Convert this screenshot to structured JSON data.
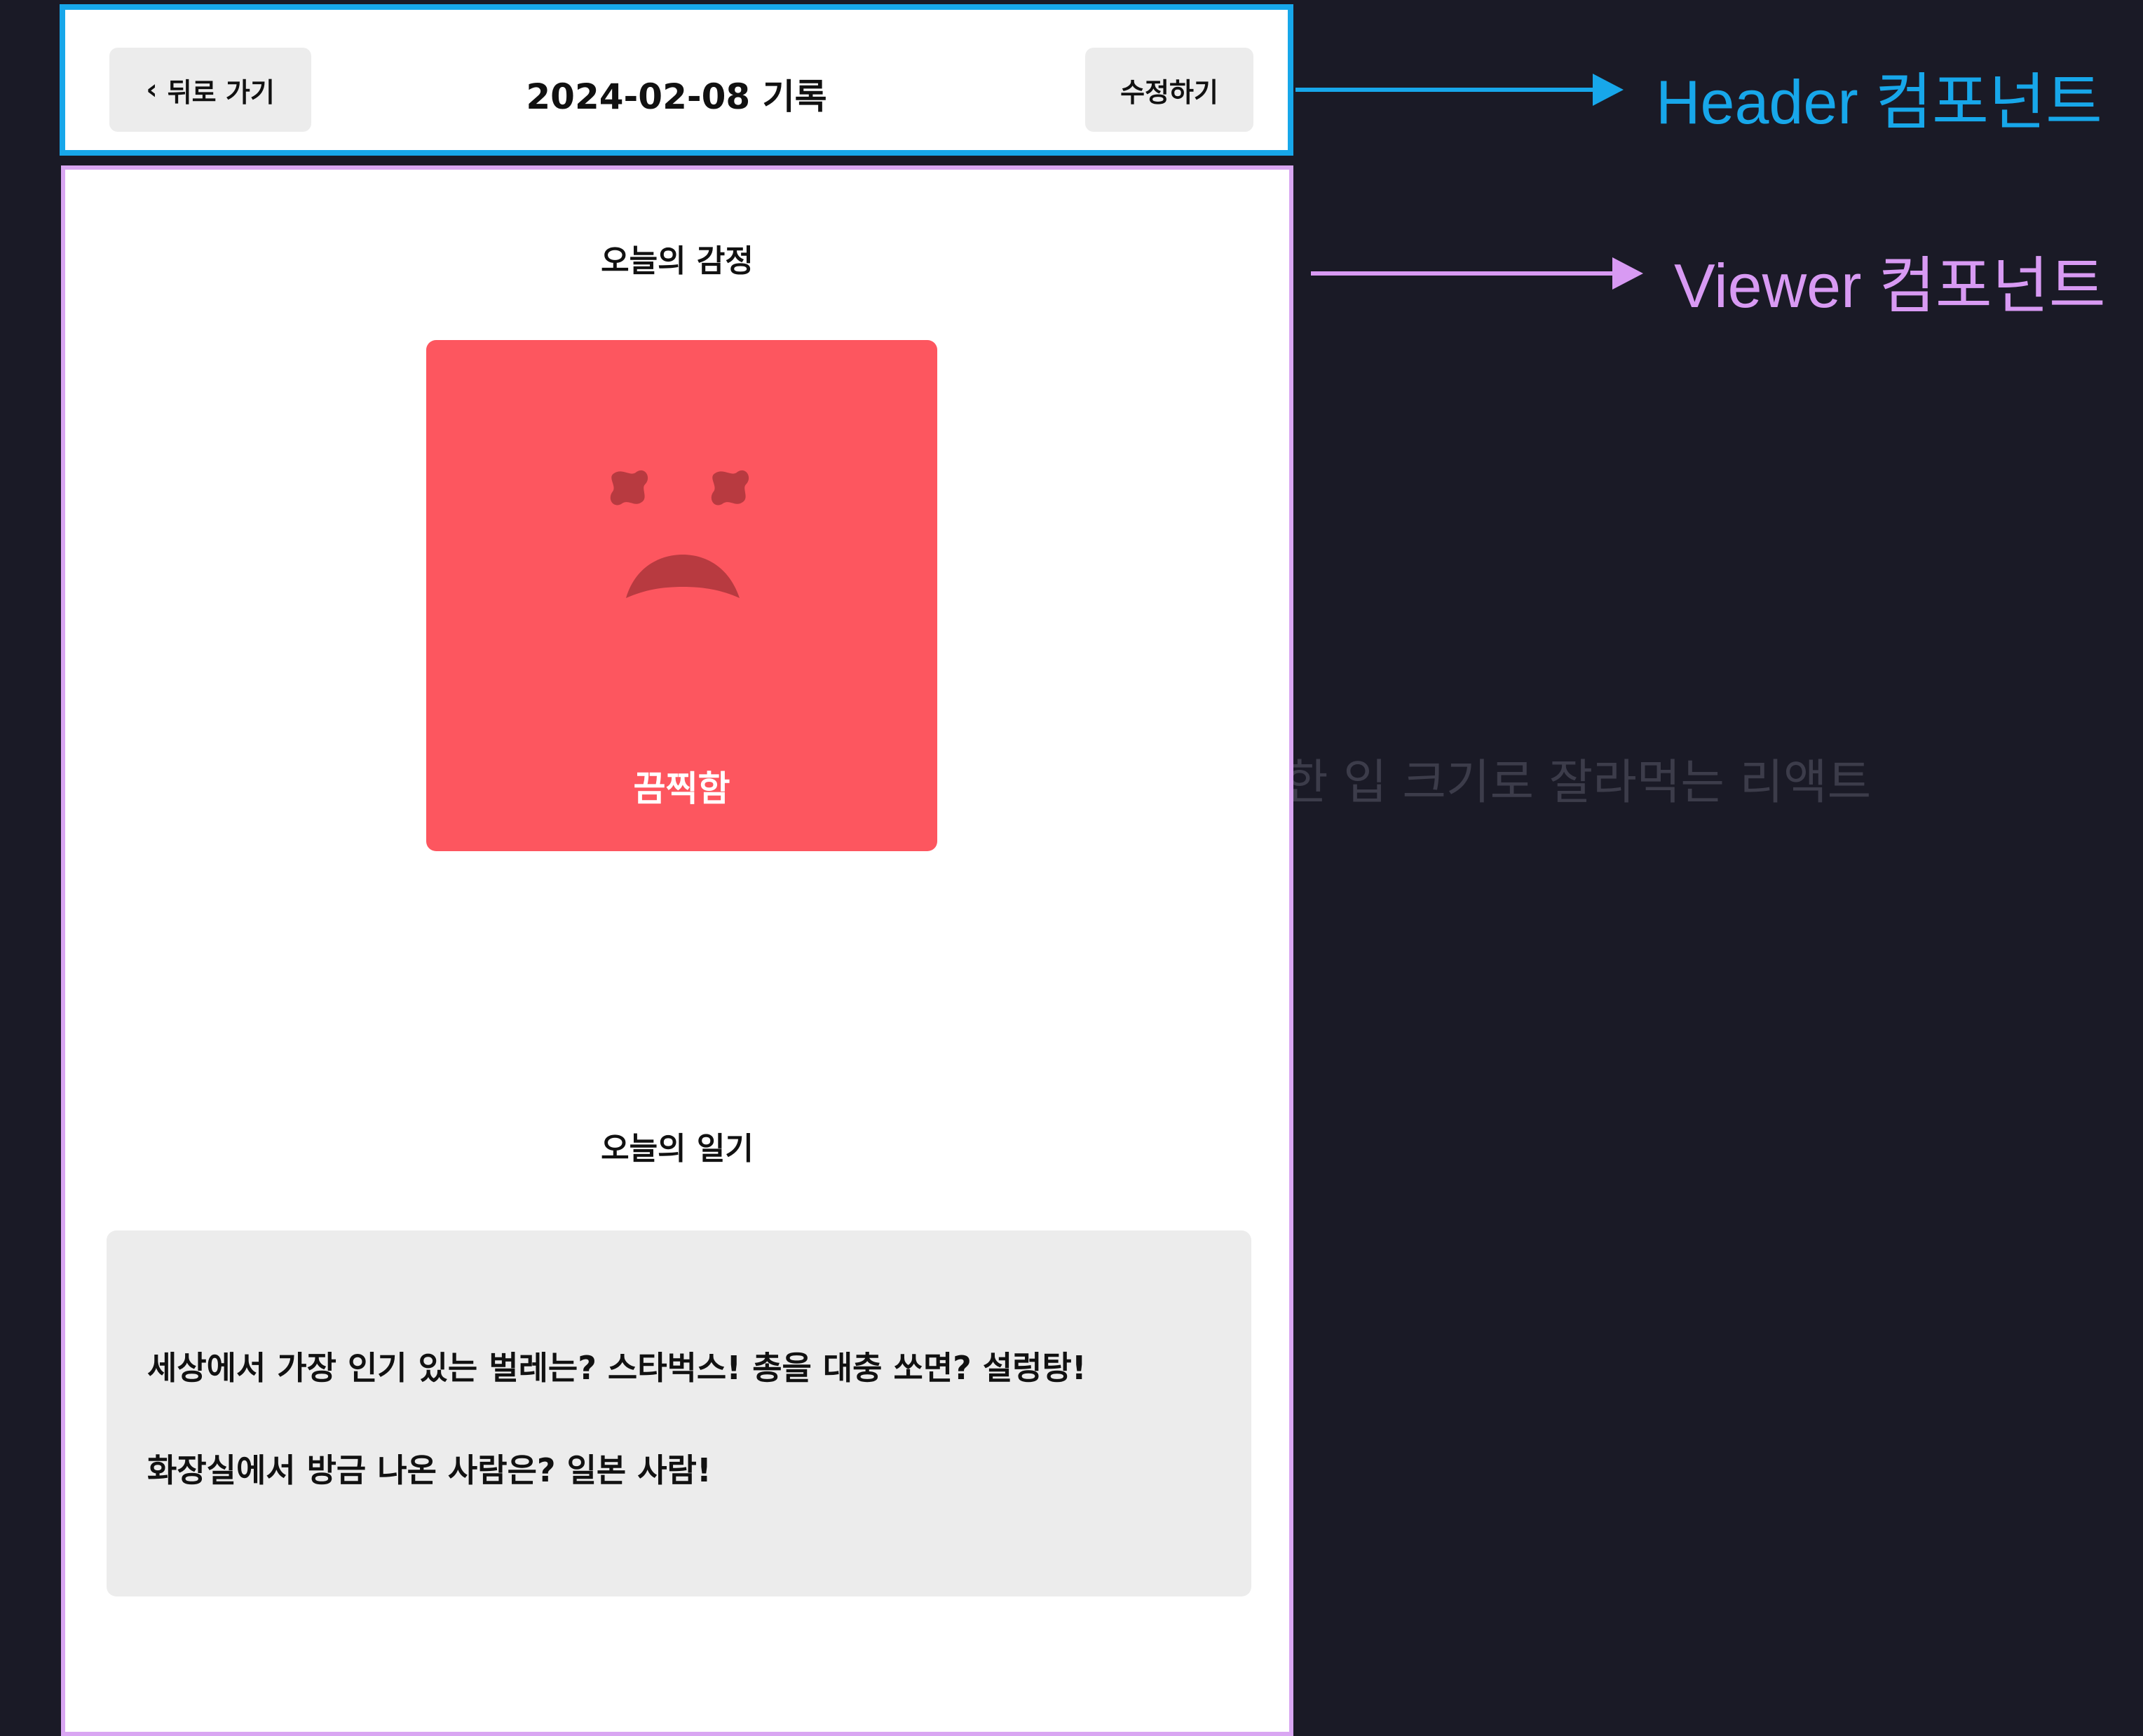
{
  "header": {
    "back_label": "뒤로 가기",
    "back_icon": "chevron-left-icon",
    "title": "2024-02-08 기록",
    "edit_label": "수정하기"
  },
  "viewer": {
    "emotion_title": "오늘의 감정",
    "emotion": {
      "label": "끔찍함",
      "icon": "terrible-face-icon",
      "color": "#fd565f"
    },
    "diary_title": "오늘의 일기",
    "diary_lines": [
      "세상에서 가장 인기 있는 벌레는? 스타벅스! 총을 대충 쏘면? 설렁탕!",
      "화장실에서 방금 나온 사람은? 일본 사람!"
    ]
  },
  "annotations": {
    "header_label": "Header 컴포넌트",
    "header_color": "#17a7ea",
    "viewer_label": "Viewer 컴포넌트",
    "viewer_color": "#d89af3"
  },
  "background_text": "한 입 크기로 잘라먹는 리액트"
}
